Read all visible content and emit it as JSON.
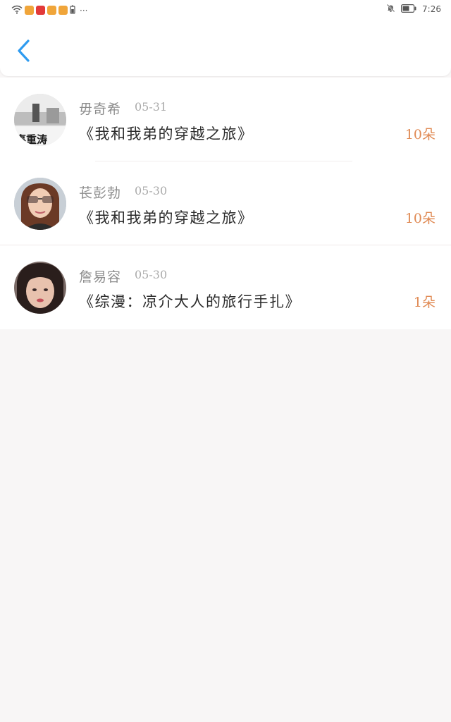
{
  "status_bar": {
    "time": "7:26",
    "notification_icons": [
      "wifi-icon",
      "app-icon",
      "app-icon",
      "app-icon",
      "app-icon",
      "battery-small-icon",
      "more-dots-icon"
    ],
    "more_label": "···"
  },
  "header": {
    "back_icon": "chevron-left-icon",
    "accent_color": "#2e9bf0"
  },
  "list": {
    "items": [
      {
        "name": "毋奇希",
        "date": "05-31",
        "title": "《我和我弟的穿越之旅》",
        "count": "10朵",
        "avatar_text": "事重涛"
      },
      {
        "name": "苌彭勃",
        "date": "05-30",
        "title": "《我和我弟的穿越之旅》",
        "count": "10朵"
      },
      {
        "name": "詹易容",
        "date": "05-30",
        "title": "《综漫：凉介大人的旅行手扎》",
        "count": "1朵"
      }
    ]
  },
  "colors": {
    "count": "#e08a54",
    "name": "#8d8d8d",
    "date": "#aaaaaa",
    "title": "#2b2b2b",
    "background": "#f8f6f6"
  }
}
